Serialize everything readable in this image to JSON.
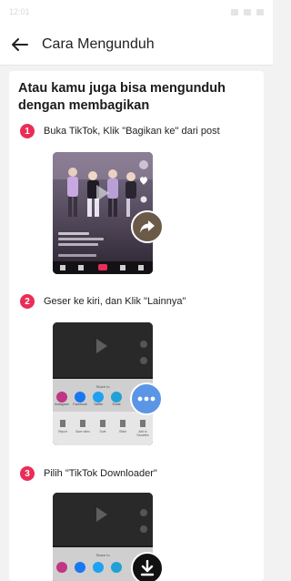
{
  "status": {
    "time": "12:01"
  },
  "appbar": {
    "title": "Cara Mengunduh"
  },
  "content": {
    "heading": "Atau kamu juga bisa mengunduh dengan membagikan",
    "steps": [
      {
        "number": "1",
        "text": "Buka TikTok, Klik \"Bagikan ke\" dari post"
      },
      {
        "number": "2",
        "text": "Geser ke kiri, dan Klik \"Lainnya\""
      },
      {
        "number": "3",
        "text": "Pilih \"TikTok Downloader\""
      }
    ],
    "share_sheet": {
      "title": "Share to",
      "apps": [
        "Instagram",
        "Facebook",
        "Twitter",
        "Email"
      ],
      "actions": [
        "Report",
        "Save video",
        "Duet",
        "Stitch",
        "Add to Favorites"
      ]
    }
  },
  "colors": {
    "accent": "#ea2d58",
    "more_badge": "#5b95e6"
  },
  "icons": [
    "back-arrow-icon",
    "share-arrow-icon",
    "more-dots-icon",
    "download-arrow-icon"
  ]
}
